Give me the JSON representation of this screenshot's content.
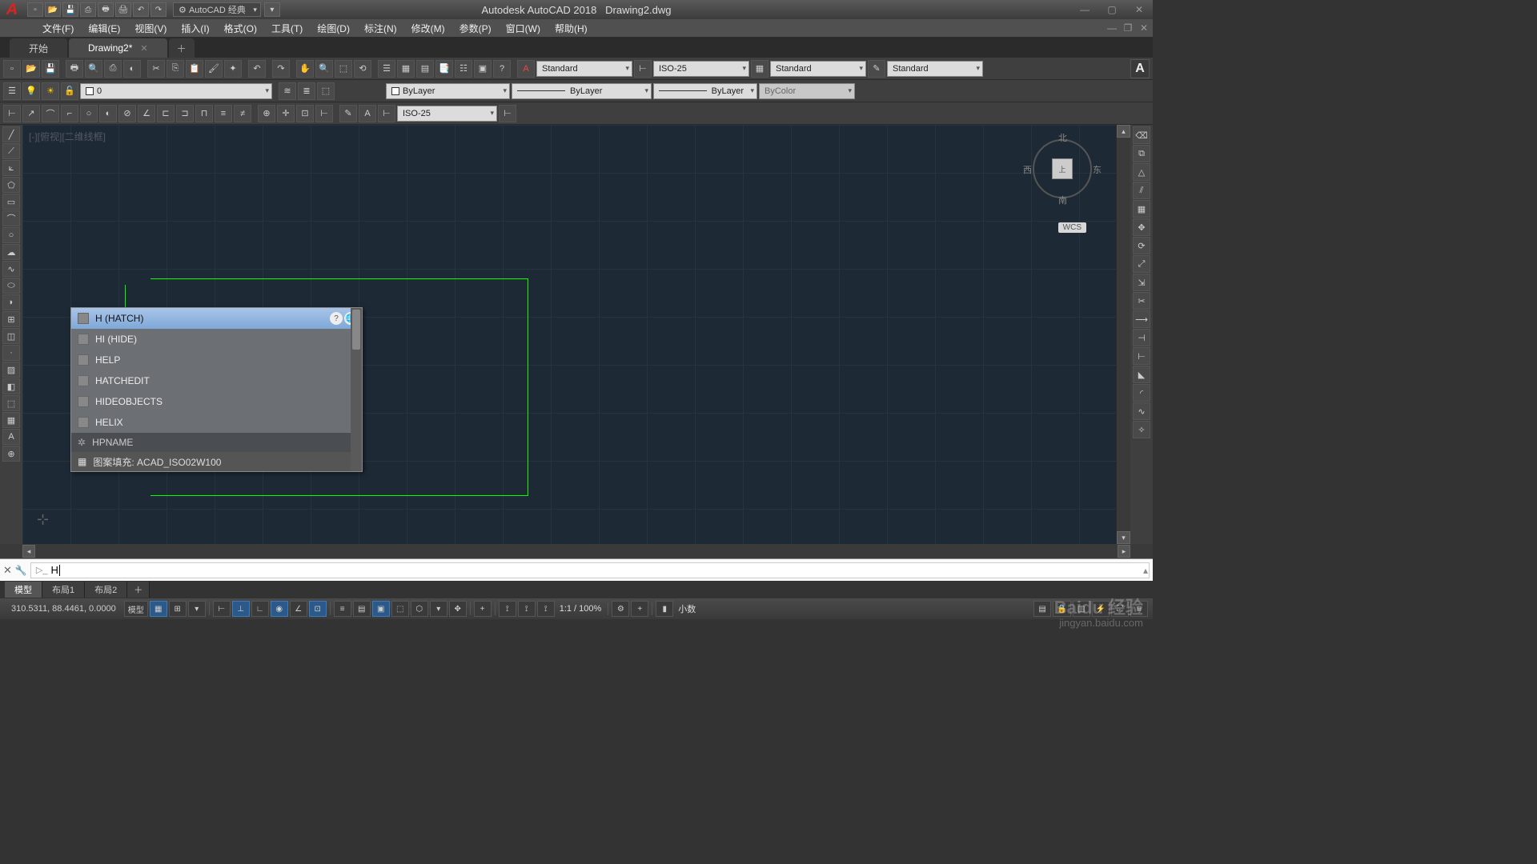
{
  "title": {
    "app": "Autodesk AutoCAD 2018",
    "file": "Drawing2.dwg"
  },
  "workspace_combo": {
    "icon": "⚙",
    "label": "AutoCAD 经典"
  },
  "menus": [
    "文件(F)",
    "编辑(E)",
    "视图(V)",
    "插入(I)",
    "格式(O)",
    "工具(T)",
    "绘图(D)",
    "标注(N)",
    "修改(M)",
    "参数(P)",
    "窗口(W)",
    "帮助(H)"
  ],
  "doc_tabs": [
    {
      "label": "开始",
      "active": false,
      "closable": false
    },
    {
      "label": "Drawing2*",
      "active": true,
      "closable": true
    }
  ],
  "layer_combo": "0",
  "props": {
    "color": "ByLayer",
    "ltype": "ByLayer",
    "lweight": "ByLayer",
    "plot": "ByColor"
  },
  "dim_combo": "ISO-25",
  "styles": {
    "text": "Standard",
    "dim": "ISO-25",
    "table": "Standard",
    "ml": "Standard"
  },
  "view_label": "[-][俯视][二维线框]",
  "compass": {
    "n": "北",
    "s": "南",
    "e": "东",
    "w": "西",
    "face": "上",
    "wcs": "WCS"
  },
  "autocomplete": {
    "items": [
      {
        "text": "H (HATCH)",
        "sel": true
      },
      {
        "text": "HI (HIDE)"
      },
      {
        "text": "HELP"
      },
      {
        "text": "HATCHEDIT"
      },
      {
        "text": "HIDEOBJECTS"
      },
      {
        "text": "HELIX"
      }
    ],
    "sysvar": "HPNAME",
    "recent_prefix": "图案填充:",
    "recent_value": "ACAD_ISO02W100"
  },
  "cmd_input": "H",
  "layout_tabs": [
    "模型",
    "布局1",
    "布局2"
  ],
  "status": {
    "coords": "310.5311, 88.4461, 0.0000",
    "space": "模型",
    "zoom": "1:1 / 100%",
    "units": "小数"
  },
  "watermark": {
    "brand": "Baidu 经验",
    "url": "jingyan.baidu.com"
  }
}
